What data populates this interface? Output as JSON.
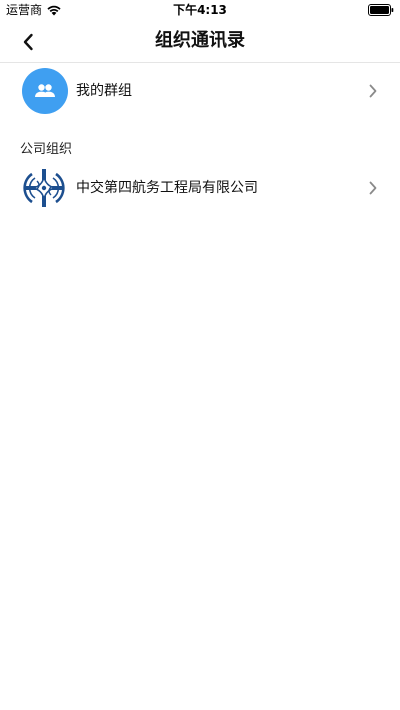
{
  "status_bar": {
    "carrier": "运营商",
    "time": "下午4:13"
  },
  "nav": {
    "title": "组织通讯录"
  },
  "groups_row": {
    "label": "我的群组"
  },
  "section": {
    "title": "公司组织"
  },
  "company_row": {
    "label": "中交第四航务工程局有限公司"
  },
  "colors": {
    "accent": "#3f9ff1",
    "logo_blue": "#1d4f8f"
  },
  "icons": {
    "back": "chevron-left-icon",
    "groups": "group-people-icon",
    "row_arrow": "chevron-right-icon",
    "company": "company-logo-icon"
  }
}
